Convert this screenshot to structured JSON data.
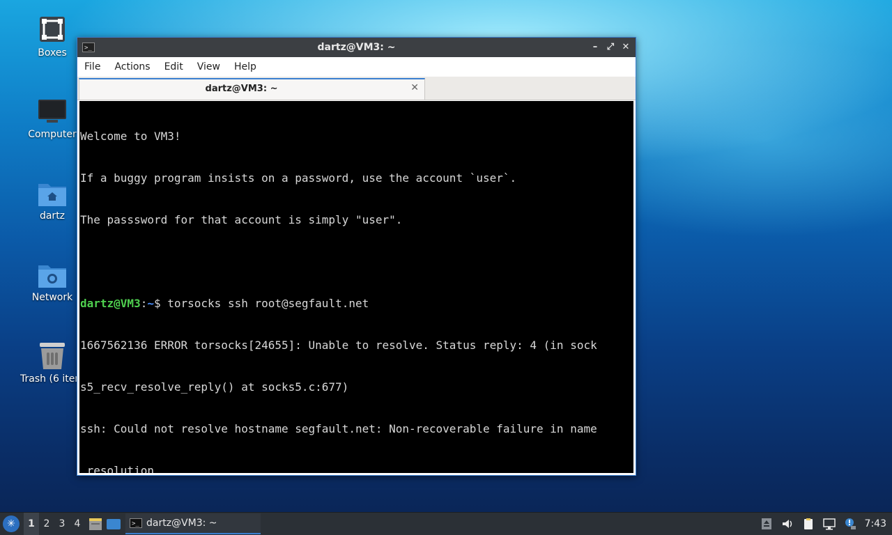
{
  "desktop": {
    "icons": [
      {
        "label": "Boxes"
      },
      {
        "label": "Computer"
      },
      {
        "label": "dartz"
      },
      {
        "label": "Network"
      },
      {
        "label": "Trash (6 item"
      }
    ]
  },
  "window": {
    "title": "dartz@VM3: ~",
    "app_icon_text": ">_",
    "controls": {
      "minimize": "–",
      "maximize": "⤢",
      "close": "✕"
    },
    "menu": [
      "File",
      "Actions",
      "Edit",
      "View",
      "Help"
    ],
    "tab": {
      "label": "dartz@VM3: ~",
      "close": "✕"
    }
  },
  "terminal": {
    "lines": [
      "Welcome to VM3!",
      "If a buggy program insists on a password, use the account `user`.",
      "The passsword for that account is simply \"user\".",
      "",
      "1667562136 ERROR torsocks[24655]: Unable to resolve. Status reply: 4 (in sock",
      "s5_recv_resolve_reply() at socks5.c:677)",
      "ssh: Could not resolve hostname segfault.net: Non-recoverable failure in name",
      " resolution"
    ],
    "prompt_user": "dartz@VM3",
    "prompt_sep": ":",
    "prompt_path": "~",
    "prompt_symbol": "$ ",
    "command": "torsocks ssh root@segfault.net"
  },
  "taskbar": {
    "workspaces": [
      "1",
      "2",
      "3",
      "4"
    ],
    "active_workspace": "1",
    "task_label": "dartz@VM3: ~",
    "clock": "7:43"
  },
  "colors": {
    "accent": "#3a7fd0",
    "prompt_user": "#4fd04f",
    "prompt_path": "#4a90ff"
  }
}
